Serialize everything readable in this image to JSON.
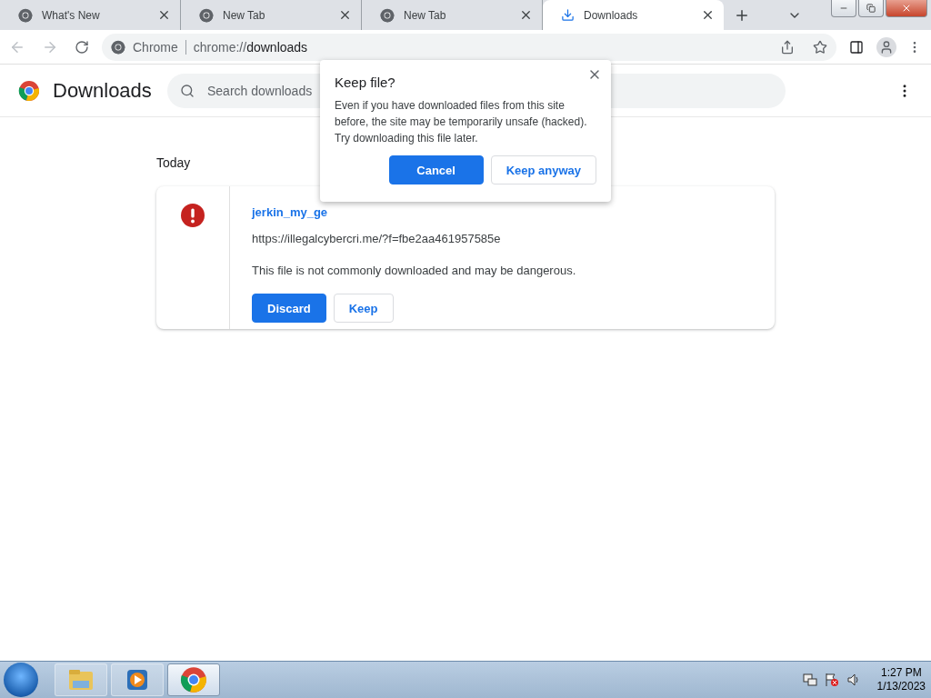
{
  "tabs": [
    {
      "title": "What's New",
      "kind": "web",
      "selected": false
    },
    {
      "title": "New Tab",
      "kind": "web",
      "selected": false
    },
    {
      "title": "New Tab",
      "kind": "web",
      "selected": false
    },
    {
      "title": "Downloads",
      "kind": "download",
      "selected": true
    }
  ],
  "toolbar": {
    "site_label": "Chrome",
    "url_prefix": "chrome://",
    "url_host": "downloads"
  },
  "page": {
    "title": "Downloads",
    "search": {
      "placeholder": "Search downloads"
    },
    "section": "Today",
    "download": {
      "file_name": "jerkin_my_ge",
      "url": "https://illegalcybercri.me/?f=fbe2aa461957585e",
      "warning": "This file is not commonly downloaded and may be dangerous.",
      "buttons": [
        {
          "label": "Discard",
          "primary": true
        },
        {
          "label": "Keep",
          "primary": false
        }
      ]
    }
  },
  "dialog": {
    "title": "Keep file?",
    "body": "Even if you have downloaded files from this site before, the site may be temporarily unsafe (hacked). Try downloading this file later.",
    "buttons": [
      {
        "label": "Cancel",
        "primary": true
      },
      {
        "label": "Keep anyway",
        "primary": false
      }
    ]
  },
  "taskbar": {
    "apps": [
      {
        "kind": "explorer",
        "active": false
      },
      {
        "kind": "media",
        "active": false
      },
      {
        "kind": "chrome",
        "active": true
      }
    ],
    "time": "1:27 PM",
    "date": "1/13/2023"
  }
}
